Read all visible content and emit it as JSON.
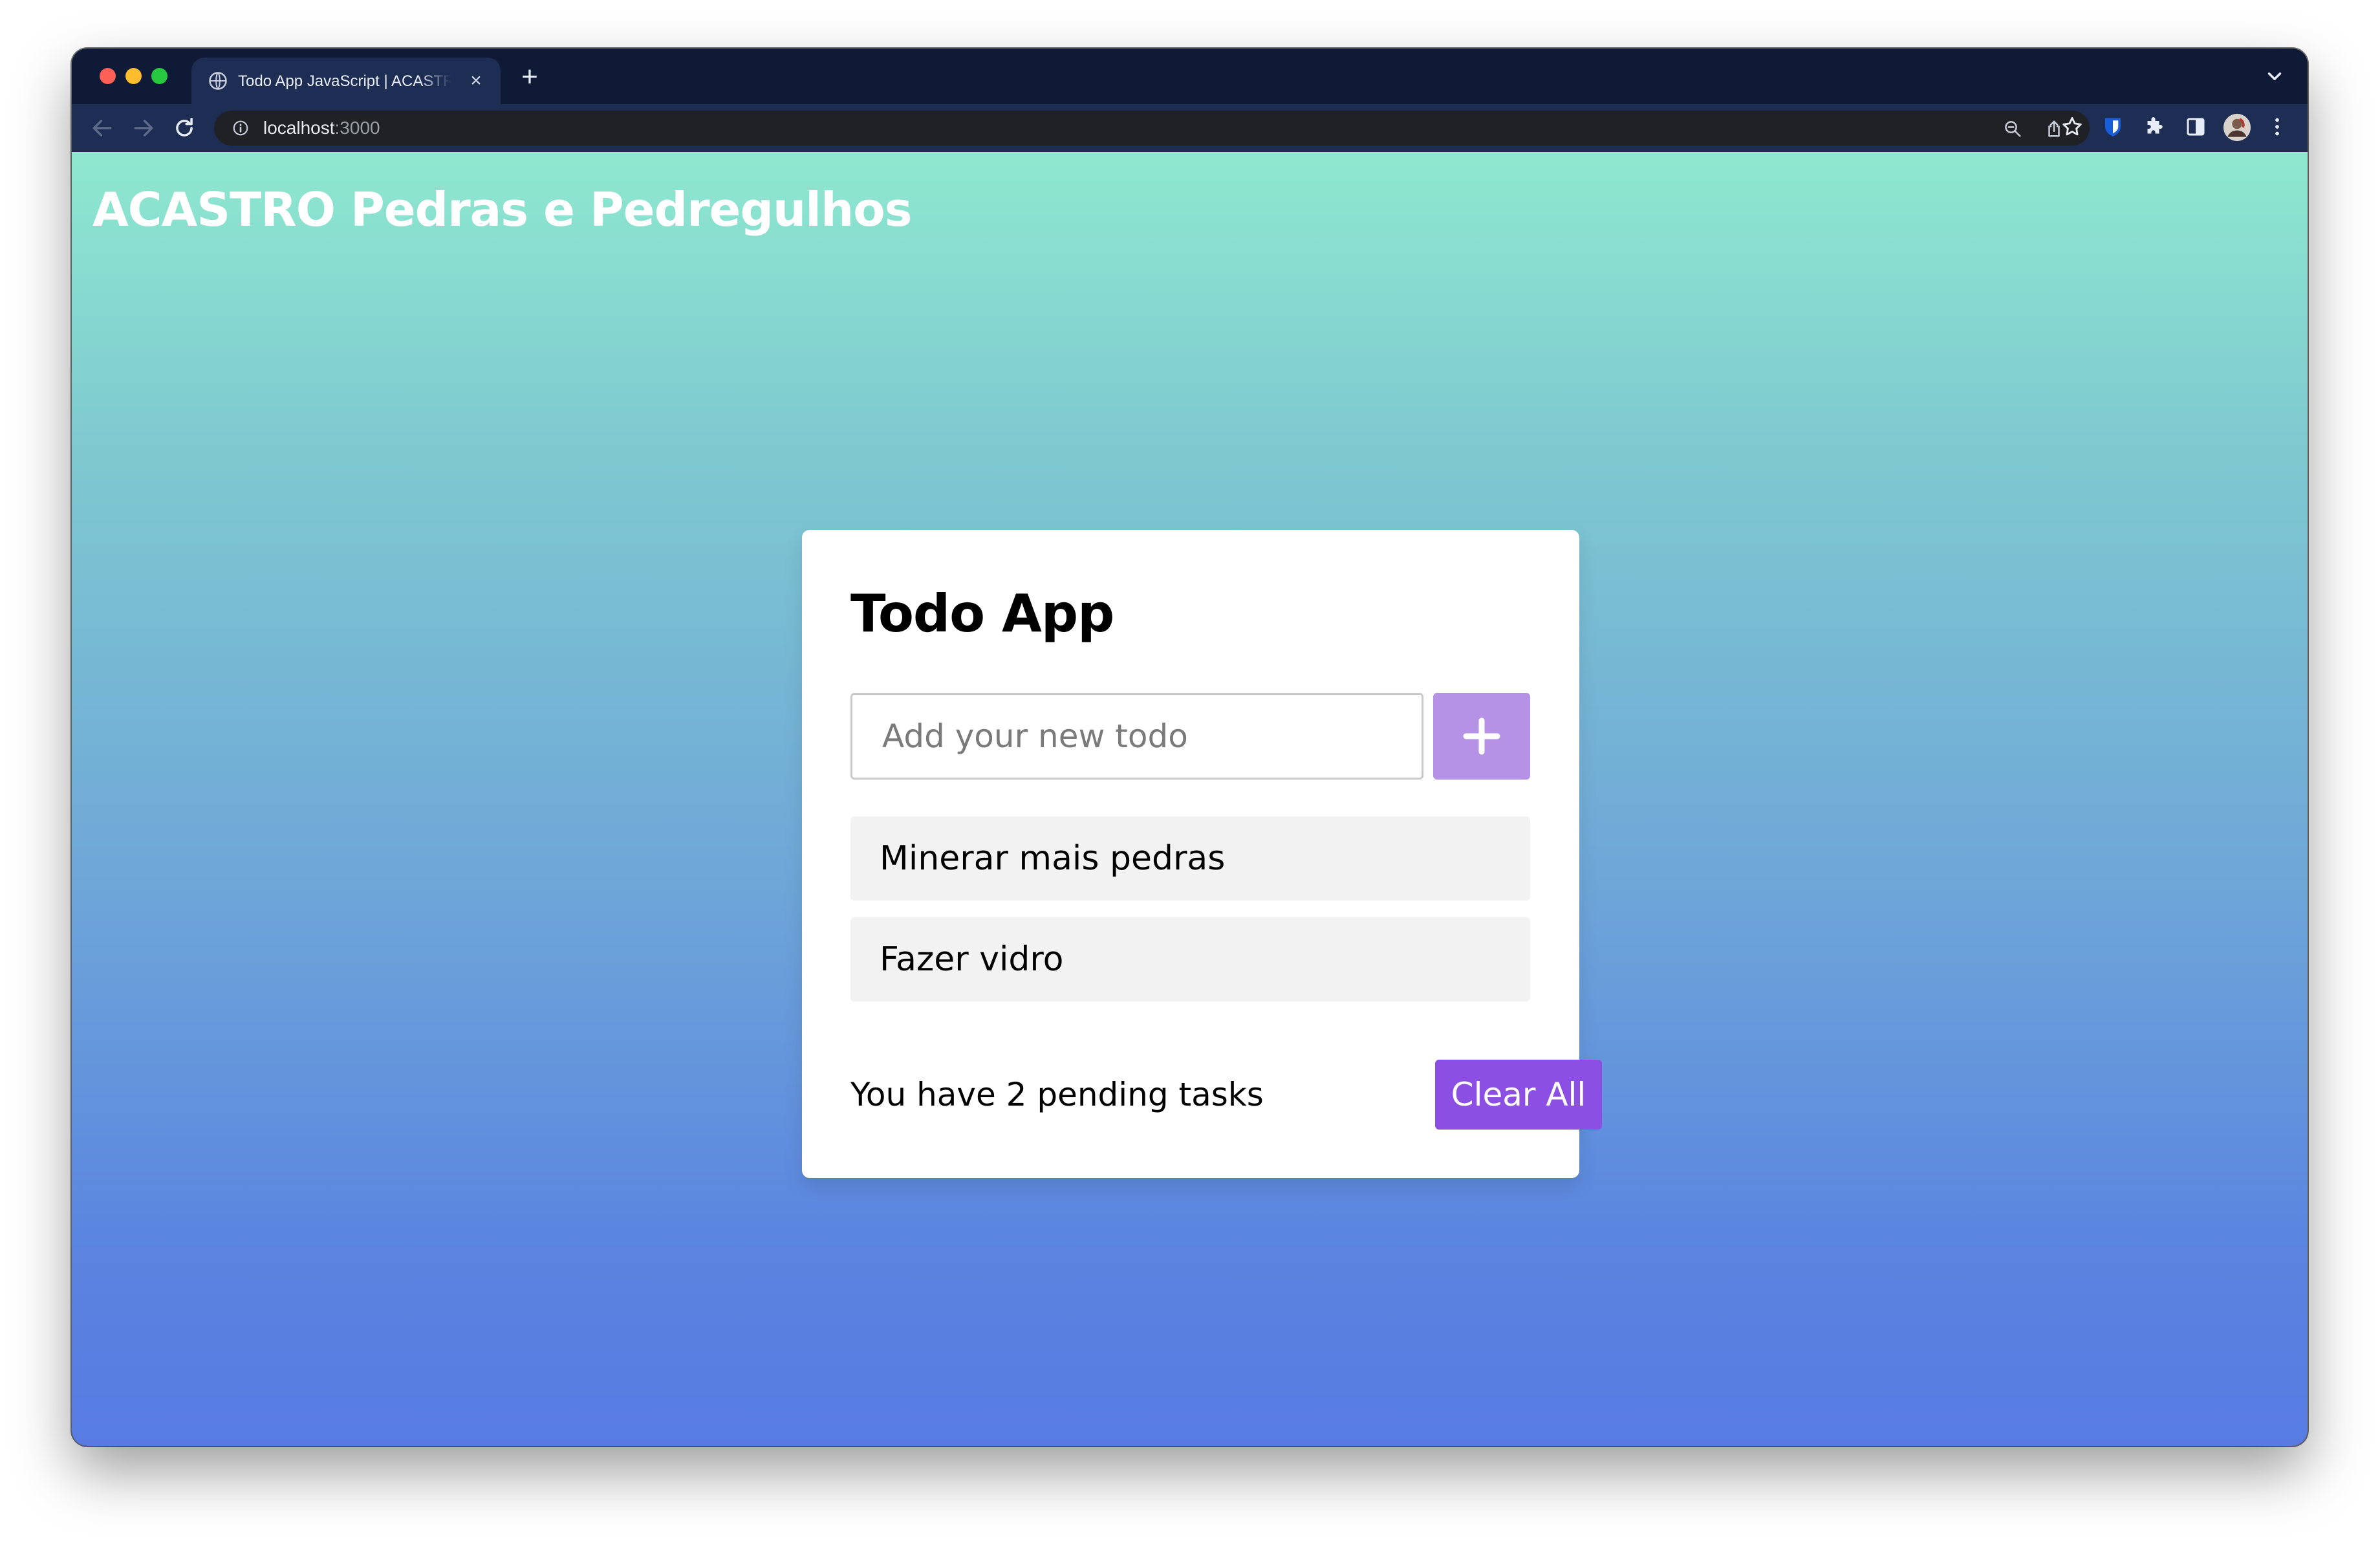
{
  "browser": {
    "tab": {
      "title": "Todo App JavaScript | ACASTRO Pedras e Pedregulhos",
      "close_icon": "×"
    },
    "new_tab_icon": "+",
    "address": {
      "host": "localhost",
      "port": ":3000"
    },
    "icons": [
      "back-arrow-icon",
      "forward-arrow-icon",
      "reload-icon",
      "info-icon",
      "zoom-icon",
      "share-icon",
      "star-icon",
      "bitwarden-icon",
      "extensions-icon",
      "side-panel-icon",
      "profile-avatar",
      "menu-icon",
      "tab-search-icon",
      "globe-icon"
    ]
  },
  "page": {
    "heading": "ACASTRO Pedras e Pedregulhos",
    "background_colors": [
      "#8ee8cf",
      "#577be2"
    ]
  },
  "todo": {
    "title": "Todo App",
    "input": {
      "placeholder": "Add your new todo",
      "value": ""
    },
    "add_button_icon": "plus-icon",
    "items": [
      {
        "text": "Minerar mais pedras"
      },
      {
        "text": "Fazer vidro"
      }
    ],
    "footer": {
      "pending_text": "You have 2 pending tasks",
      "clear_button_label": "Clear All"
    },
    "colors": {
      "add_button": "#b592e6",
      "clear_button": "#8c4fe3",
      "item_background": "#f2f2f2"
    }
  }
}
